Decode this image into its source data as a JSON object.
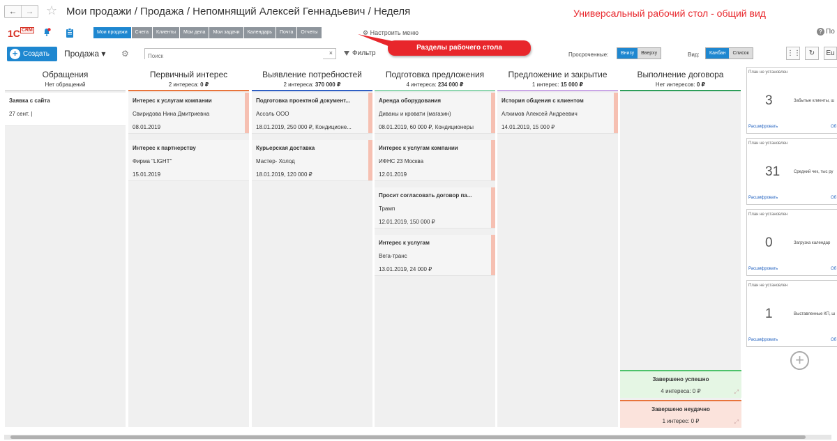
{
  "titlebar": {
    "back": "←",
    "forward": "→",
    "title": "Мои продажи / Продажа / Непомнящий Алексей Геннадьевич / Неделя",
    "red_title": "Универсальный рабочий стол - общий вид"
  },
  "logo": {
    "text": "1С",
    "badge": "CRM"
  },
  "sections": [
    {
      "label": "Мои продажи",
      "active": true
    },
    {
      "label": "Счета",
      "active": false
    },
    {
      "label": "Клиенты",
      "active": false
    },
    {
      "label": "Мои дела",
      "active": false
    },
    {
      "label": "Мои задачи",
      "active": false
    },
    {
      "label": "Календарь",
      "active": false
    },
    {
      "label": "Почта",
      "active": false
    },
    {
      "label": "Отчеты",
      "active": false
    }
  ],
  "customize_menu": "Настроить меню",
  "help_label": "По",
  "callout": "Разделы рабочего стола",
  "toolbar": {
    "create": "Создать",
    "sale_dropdown": "Продажа ▾",
    "search_placeholder": "Поиск",
    "search_clear": "×",
    "filter": "Фильтр",
    "overdue_label": "Просроченные:",
    "overdue_bottom": "Внизу",
    "overdue_top": "Вверху",
    "view_label": "Вид:",
    "view_kanban": "Канбан",
    "view_list": "Список",
    "last_btn": "Eu"
  },
  "columns": [
    {
      "title": "Обращения",
      "sub_text": "Нет обращений",
      "sub_amount": "",
      "color": "#dddddd",
      "cards": [
        {
          "l1": "Заявка с сайта",
          "l2": "27 сент. |",
          "l3": "",
          "strip": false
        }
      ]
    },
    {
      "title": "Первичный интерес",
      "sub_text": "2 интереса: ",
      "sub_amount": "0 ₽",
      "color": "#e8743b",
      "cards": [
        {
          "l1": "Интерес к услугам компании",
          "l2": "Свиридова Нина Дмитриевна",
          "l3": "08.01.2019",
          "strip": true
        },
        {
          "l1": "Интерес к партнерству",
          "l2": "Фирма \"LIGHT\"",
          "l3": "15.01.2019",
          "strip": false
        }
      ]
    },
    {
      "title": "Выявление потребностей",
      "sub_text": "2 интереса: ",
      "sub_amount": "370 000 ₽",
      "color": "#2f5fc4",
      "cards": [
        {
          "l1": "Подготовка проектной документ...",
          "l2": "Ассоль ООО",
          "l3": "18.01.2019, 250 000 ₽, Кондиционе...",
          "strip": true
        },
        {
          "l1": "Курьерская доставка",
          "l2": "Мастер- Холод",
          "l3": "18.01.2019, 120 000 ₽",
          "strip": true
        }
      ]
    },
    {
      "title": "Подготовка предложения",
      "sub_text": "4 интереса: ",
      "sub_amount": "234 000 ₽",
      "color": "#8fd6b0",
      "cards": [
        {
          "l1": "Аренда оборудования",
          "l2": "Диваны и кровати (магазин)",
          "l3": "08.01.2019, 60 000 ₽, Кондиционеры",
          "strip": true
        },
        {
          "l1": "Интерес к услугам компании",
          "l2": "ИФНС 23 Москва",
          "l3": "12.01.2019",
          "strip": true
        },
        {
          "l1": "Просит согласовать договор па...",
          "l2": "Трамп",
          "l3": "12.01.2019, 150 000 ₽",
          "strip": true
        },
        {
          "l1": "Интерес к услугам",
          "l2": "Вега-транс",
          "l3": "13.01.2019, 24 000 ₽",
          "strip": true
        }
      ]
    },
    {
      "title": "Предложение и закрытие",
      "sub_text": "1 интерес: ",
      "sub_amount": "15 000 ₽",
      "color": "#c9a6e6",
      "cards": [
        {
          "l1": "История общения с клиентом",
          "l2": "Алхимов Алексей Андреевич",
          "l3": "14.01.2019, 15 000 ₽",
          "strip": true
        }
      ]
    },
    {
      "title": "Выполнение договора",
      "sub_text": "Нет интересов: ",
      "sub_amount": "0 ₽",
      "color": "#2e9e5a",
      "cards": []
    }
  ],
  "done_success": {
    "title": "Завершено успешно",
    "sub": "4 интереса: 0 ₽",
    "color": "#4cc26a",
    "bg": "#e5f6e4"
  },
  "done_fail": {
    "title": "Завершено неудачно",
    "sub": "1 интерес: 0 ₽",
    "color": "#e8743b",
    "bg": "#fbe3dc"
  },
  "widgets": [
    {
      "plan": "План не установлен",
      "value": "3",
      "desc": "Забытые клиенты, ш",
      "decode": "Расшифровать",
      "ob": "Об"
    },
    {
      "plan": "План не установлен",
      "value": "31",
      "desc": "Средний чек, тыс ру",
      "decode": "Расшифровать",
      "ob": "Об"
    },
    {
      "plan": "План не установлен",
      "value": "0",
      "desc": "Загрузка календар",
      "decode": "Расшифровать",
      "ob": "Об"
    },
    {
      "plan": "План не установлен",
      "value": "1",
      "desc": "Выставленные КП, ш",
      "decode": "Расшифровать",
      "ob": "Об"
    }
  ],
  "add_widget": "+"
}
